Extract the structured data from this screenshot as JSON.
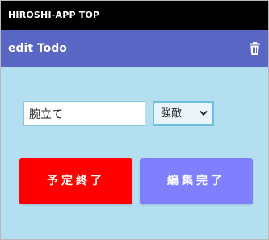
{
  "app": {
    "topbar_title": "HIROSHI-APP TOP"
  },
  "header": {
    "title": "edit Todo",
    "delete_icon": "trash-icon"
  },
  "form": {
    "task_value": "腕立て",
    "category_selected": "強敵",
    "select_icon": "chevron-down-icon"
  },
  "actions": {
    "finish_label": "予定終了",
    "edit_done_label": "編集完了"
  },
  "colors": {
    "topbar": "#000000",
    "header": "#5a66c4",
    "background": "#b3dff0",
    "finish_button": "#ff0000",
    "edit_button": "#8080ff"
  }
}
